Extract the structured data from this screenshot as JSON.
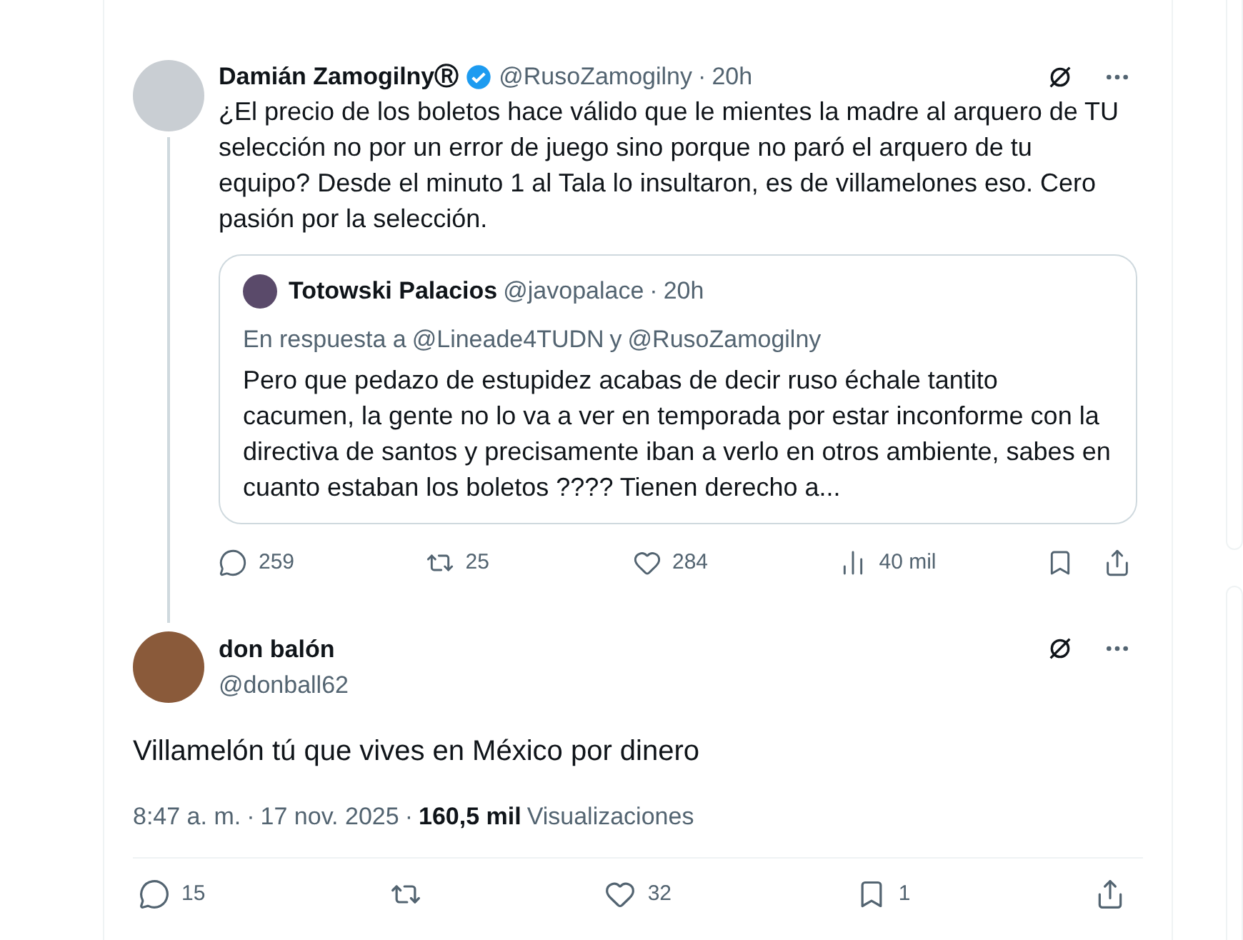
{
  "separator": "·",
  "main_post": {
    "author": "Damián Zamogilny",
    "author_badge": "Ⓡ",
    "verified": true,
    "handle": "@RusoZamogilny",
    "time": "20h",
    "text": "¿El precio de los boletos hace válido que le mientes la madre al arquero de TU selección no por un error de juego sino porque no paró el arquero de tu equipo? Desde el minuto 1 al Tala lo insultaron, es de villamelones eso. Cero pasión por la selección.",
    "quote": {
      "author": "Totowski Palacios",
      "handle": "@javopalace",
      "time": "20h",
      "reply_prefix": "En respuesta a",
      "reply_to": [
        "@Lineade4TUDN",
        "@RusoZamogilny"
      ],
      "reply_joiner": "y",
      "text": "Pero que pedazo de estupidez acabas de decir ruso échale tantito cacumen, la gente no lo va a ver en temporada por estar inconforme con la directiva de santos y precisamente iban a verlo en otros ambiente, sabes en cuanto estaban los boletos ???? Tienen derecho a..."
    },
    "actions": [
      {
        "kind": "reply",
        "count": "259"
      },
      {
        "kind": "repost",
        "count": "25"
      },
      {
        "kind": "like",
        "count": "284"
      },
      {
        "kind": "views",
        "count": "40 mil"
      },
      {
        "kind": "bookmark"
      },
      {
        "kind": "share"
      }
    ]
  },
  "reply_post": {
    "author": "don balón",
    "handle": "@donball62",
    "text": "Villamelón tú que vives en México por dinero",
    "time": "8:47 a. m.",
    "date": "17 nov. 2025",
    "views_count": "160,5 mil",
    "views_label": "Visualizaciones",
    "actions": [
      {
        "kind": "reply",
        "count": "15"
      },
      {
        "kind": "repost"
      },
      {
        "kind": "like",
        "count": "32"
      },
      {
        "kind": "bookmark",
        "count": "1"
      },
      {
        "kind": "share"
      }
    ]
  }
}
